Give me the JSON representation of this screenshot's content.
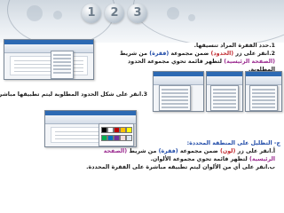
{
  "banner": {
    "numbers": [
      "1",
      "2",
      "3"
    ]
  },
  "step1": "1.حدد الفقرة المراد تنسيقها.",
  "step2": {
    "prefix": "2.انقر على زر",
    "btn": "(الحدود)",
    "mid1": "ضمن مجموعة",
    "grp": "(فقرة)",
    "mid2": "من شريط",
    "tab": "(الصفحة الرئيسية)",
    "rest": "لتظهر قائمة تحوي مجموعة الحدود",
    "line3": "المطلوبة."
  },
  "step3": "3.انقر على شكل الحدود المطلوبة ليتم تطبيقها مباشرة.",
  "shading": {
    "bullet": "ج-",
    "heading": "التظليل على المنطقة المحددة:",
    "a_prefix": "أ.انقر على زر",
    "a_btn": "(لون)",
    "a_mid1": "ضمن مجموعة",
    "a_grp": "(فقرة)",
    "a_mid2": "من شريط",
    "a_tab": "(الصفحة",
    "a_tab2": "الرئيسية)",
    "a_rest": "لتظهر قائمة تحوي مجموعة الألوان.",
    "b": "ب.انقر على أي من الألوان ليتم تطبيقه مباشرة على الفقرة المحددة."
  },
  "colors": {
    "red": "#c0282d",
    "blue": "#1f4aa8",
    "purple": "#9a2a8f",
    "accent": "#2d6ab3"
  },
  "palette": [
    "#000000",
    "#ffffff",
    "#c00000",
    "#ffc000",
    "#ffff00",
    "#00b050",
    "#0070c0",
    "#7030a0",
    "#f2dcdb",
    "#dbe5f1"
  ]
}
